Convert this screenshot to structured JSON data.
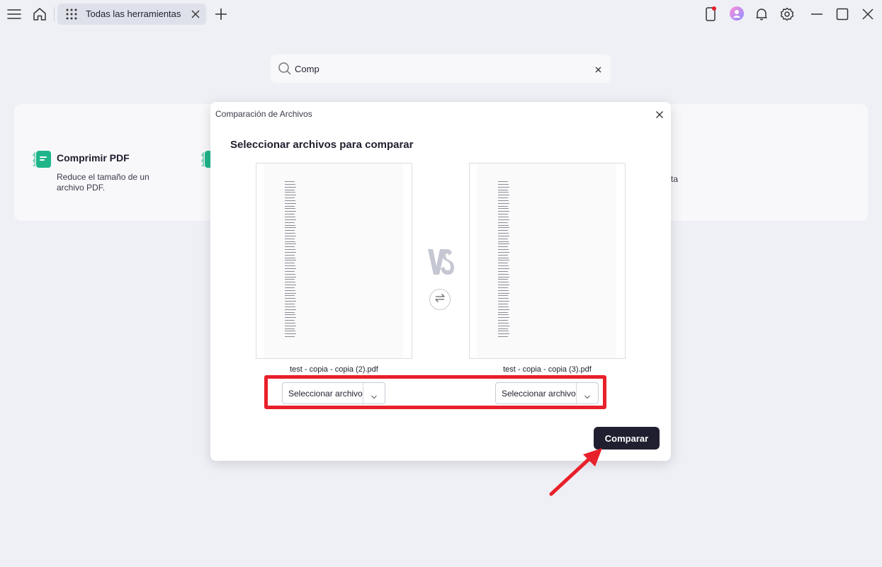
{
  "topbar": {
    "tab_label": "Todas las herramientas",
    "icons": [
      "menu-icon",
      "home-icon",
      "grid-icon",
      "close-icon",
      "plus-icon",
      "phone-icon",
      "avatar",
      "bell-icon",
      "gear-icon",
      "minimize-icon",
      "maximize-icon",
      "close-window-icon"
    ]
  },
  "search": {
    "value": "Comp",
    "placeholder": ""
  },
  "results": {
    "tool_1": {
      "title": "Comprimir PDF",
      "description": "Reduce el tamaño de un archivo PDF."
    },
    "tool_2_fragment": "ta"
  },
  "modal": {
    "title": "Comparación de Archivos",
    "heading": "Seleccionar archivos para comparar",
    "left_file": "test - copia - copia (2).pdf",
    "right_file": "test - copia - copia (3).pdf",
    "vs_label": "VS",
    "left_select": "Seleccionar archivo",
    "right_select": "Seleccionar archivo",
    "compare_button": "Comparar"
  },
  "colors": {
    "accent_green": "#1fb58a",
    "highlight_red": "#e8202a",
    "button_dark": "#1f1f30",
    "background": "#eff0f6"
  }
}
